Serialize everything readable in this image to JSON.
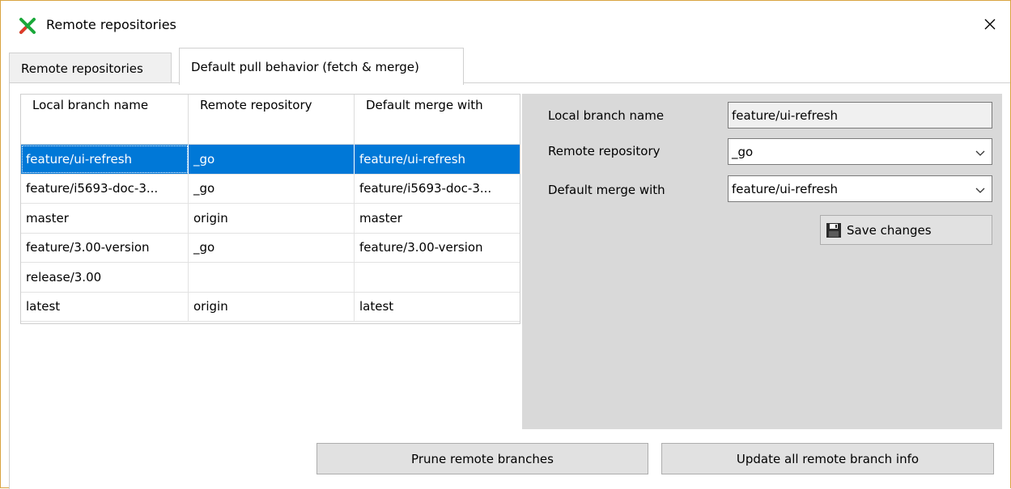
{
  "window": {
    "title": "Remote repositories"
  },
  "tabs": [
    {
      "label": "Remote repositories",
      "active": false
    },
    {
      "label": "Default pull behavior (fetch & merge)",
      "active": true
    }
  ],
  "grid": {
    "headers": [
      "Local branch name",
      "Remote repository",
      "Default merge with"
    ],
    "rows": [
      {
        "local": "feature/ui-refresh",
        "remote": "_go",
        "merge": "feature/ui-refresh",
        "selected": true
      },
      {
        "local": "feature/i5693-doc-3...",
        "remote": "_go",
        "merge": "feature/i5693-doc-3...",
        "selected": false
      },
      {
        "local": "master",
        "remote": "origin",
        "merge": "master",
        "selected": false
      },
      {
        "local": "feature/3.00-version",
        "remote": "_go",
        "merge": "feature/3.00-version",
        "selected": false
      },
      {
        "local": "release/3.00",
        "remote": "",
        "merge": "",
        "selected": false
      },
      {
        "local": "latest",
        "remote": "origin",
        "merge": "latest",
        "selected": false
      }
    ]
  },
  "details": {
    "local_branch_label": "Local branch name",
    "local_branch_value": "feature/ui-refresh",
    "remote_repo_label": "Remote repository",
    "remote_repo_value": "_go",
    "merge_with_label": "Default merge with",
    "merge_with_value": "feature/ui-refresh",
    "save_label": "Save changes"
  },
  "buttons": {
    "prune_label": "Prune remote branches",
    "update_label": "Update all remote branch info"
  },
  "colors": {
    "selection": "#0078d7",
    "panel_bg": "#d9d9d9",
    "window_border": "#d9a441"
  },
  "icons": {
    "app": "git-extensions-logo-icon",
    "close": "close-icon",
    "save": "floppy-disk-icon",
    "dropdown": "chevron-down-icon"
  }
}
